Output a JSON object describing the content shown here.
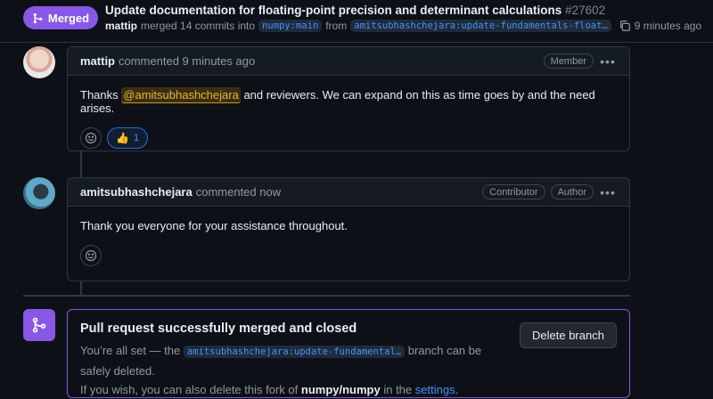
{
  "header": {
    "status_label": "Merged",
    "title": "Update documentation for floating-point precision and determinant calculations",
    "number": "#27602",
    "merger": "mattip",
    "merge_text_1": "merged 14 commits into",
    "base_branch": "numpy:main",
    "merge_text_2": "from",
    "head_branch": "amitsubhashchejara:update-fundamentals-float…",
    "time": "9 minutes ago",
    "status_color": "#8957e5"
  },
  "comments": [
    {
      "author": "mattip",
      "action": "commented 9 minutes ago",
      "badges": [
        "Member"
      ],
      "body_prefix": "Thanks",
      "mention": "@amitsubhashchejara",
      "body_suffix": "and reviewers. We can expand on this as time goes by and the need arises.",
      "reaction_emoji": "👍",
      "reaction_count": "1"
    },
    {
      "author": "amitsubhashchejara",
      "action": "commented now",
      "badges": [
        "Contributor",
        "Author"
      ],
      "body": "Thank you everyone for your assistance throughout."
    }
  ],
  "merge_box": {
    "title": "Pull request successfully merged and closed",
    "text_1": "You’re all set — the",
    "branch": "amitsubhashchejara:update-fundamental…",
    "text_2": "branch can be safely deleted.",
    "text_3": "If you wish, you can also delete this fork of",
    "repo": "numpy/numpy",
    "text_4": "in the",
    "settings_link": "settings",
    "text_5": ".",
    "delete_button": "Delete branch"
  },
  "icons": {
    "merge": "git-merge-icon",
    "copy": "copy-icon",
    "kebab": "kebab-horizontal-icon",
    "smiley": "smiley-icon"
  }
}
